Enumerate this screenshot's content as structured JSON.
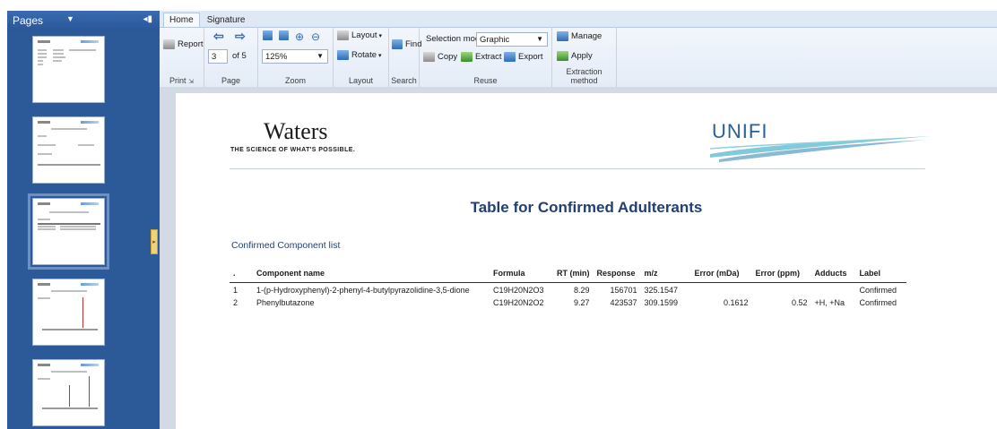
{
  "pages_panel": {
    "title": "Pages",
    "thumbnail_count": 5,
    "selected_page": 3
  },
  "ribbon": {
    "tabs": [
      {
        "label": "Home",
        "active": true
      },
      {
        "label": "Signature",
        "active": false
      }
    ],
    "print": {
      "report_label": "Report",
      "group_label": "Print"
    },
    "page": {
      "current": "3",
      "of_label": "of 5",
      "group_label": "Page"
    },
    "zoom": {
      "value": "125%",
      "group_label": "Zoom"
    },
    "layout": {
      "layout_label": "Layout",
      "rotate_label": "Rotate",
      "group_label": "Layout"
    },
    "search": {
      "find_label": "Find",
      "group_label": "Search"
    },
    "reuse": {
      "selection_mode_label": "Selection mode",
      "selection_mode_value": "Graphic",
      "copy_label": "Copy",
      "extract_label": "Extract",
      "export_label": "Export",
      "group_label": "Reuse"
    },
    "extraction": {
      "manage_label": "Manage",
      "apply_label": "Apply",
      "group_label": "Extraction method"
    }
  },
  "document": {
    "brand_name": "Waters",
    "brand_tagline": "THE SCIENCE OF WHAT'S POSSIBLE.",
    "product_logo": "UNIFI",
    "title": "Table for Confirmed Adulterants",
    "section_title": "Confirmed Component list",
    "table": {
      "headers": [
        ".",
        "Component name",
        "Formula",
        "RT (min)",
        "Response",
        "m/z",
        "Error (mDa)",
        "Error (ppm)",
        "Adducts",
        "Label"
      ],
      "rows": [
        [
          "1",
          "1-(p-Hydroxyphenyl)-2-phenyl-4-butylpyrazolidine-3,5-dione",
          "C19H20N2O3",
          "8.29",
          "156701",
          "325.1547",
          "",
          "",
          "",
          "Confirmed"
        ],
        [
          "2",
          "Phenylbutazone",
          "C19H20N2O2",
          "9.27",
          "423537",
          "309.1599",
          "0.1612",
          "0.52",
          "+H, +Na",
          "Confirmed"
        ]
      ]
    }
  },
  "colors": {
    "panel_blue": "#2c5a99",
    "title_navy": "#213f73",
    "unifi_blue": "#2a5f9e",
    "swoosh_teal": "#58b8cc"
  }
}
